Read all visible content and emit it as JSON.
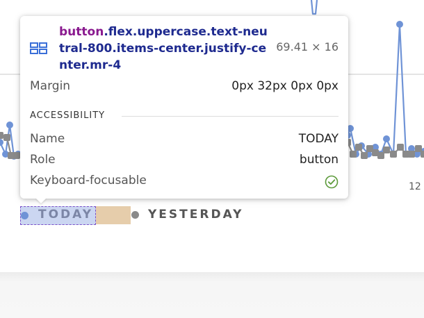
{
  "tooltip": {
    "selector_tag": "button",
    "selector_classes": ".flex.uppercase.text-neutral-800.items-center.justify-center.mr-4",
    "dimensions": "69.41 × 16",
    "margin_label": "Margin",
    "margin_value": "0px 32px 0px 0px",
    "section_title": "ACCESSIBILITY",
    "name_label": "Name",
    "name_value": "TODAY",
    "role_label": "Role",
    "role_value": "button",
    "focusable_label": "Keyboard-focusable",
    "focusable_value": true
  },
  "legend": {
    "today_label": "TODAY",
    "yesterday_label": "YESTERDAY",
    "today_color": "#6f93d6",
    "yesterday_color": "#8a8a8a"
  },
  "axis": {
    "tick_label": "12"
  },
  "colors": {
    "selector_class_color": "#1e2a8f",
    "selector_tag_color": "#8a1a8f",
    "highlight_content": "#a0b4e6",
    "highlight_margin": "#e2c49c",
    "check_color": "#5c9a3a"
  }
}
